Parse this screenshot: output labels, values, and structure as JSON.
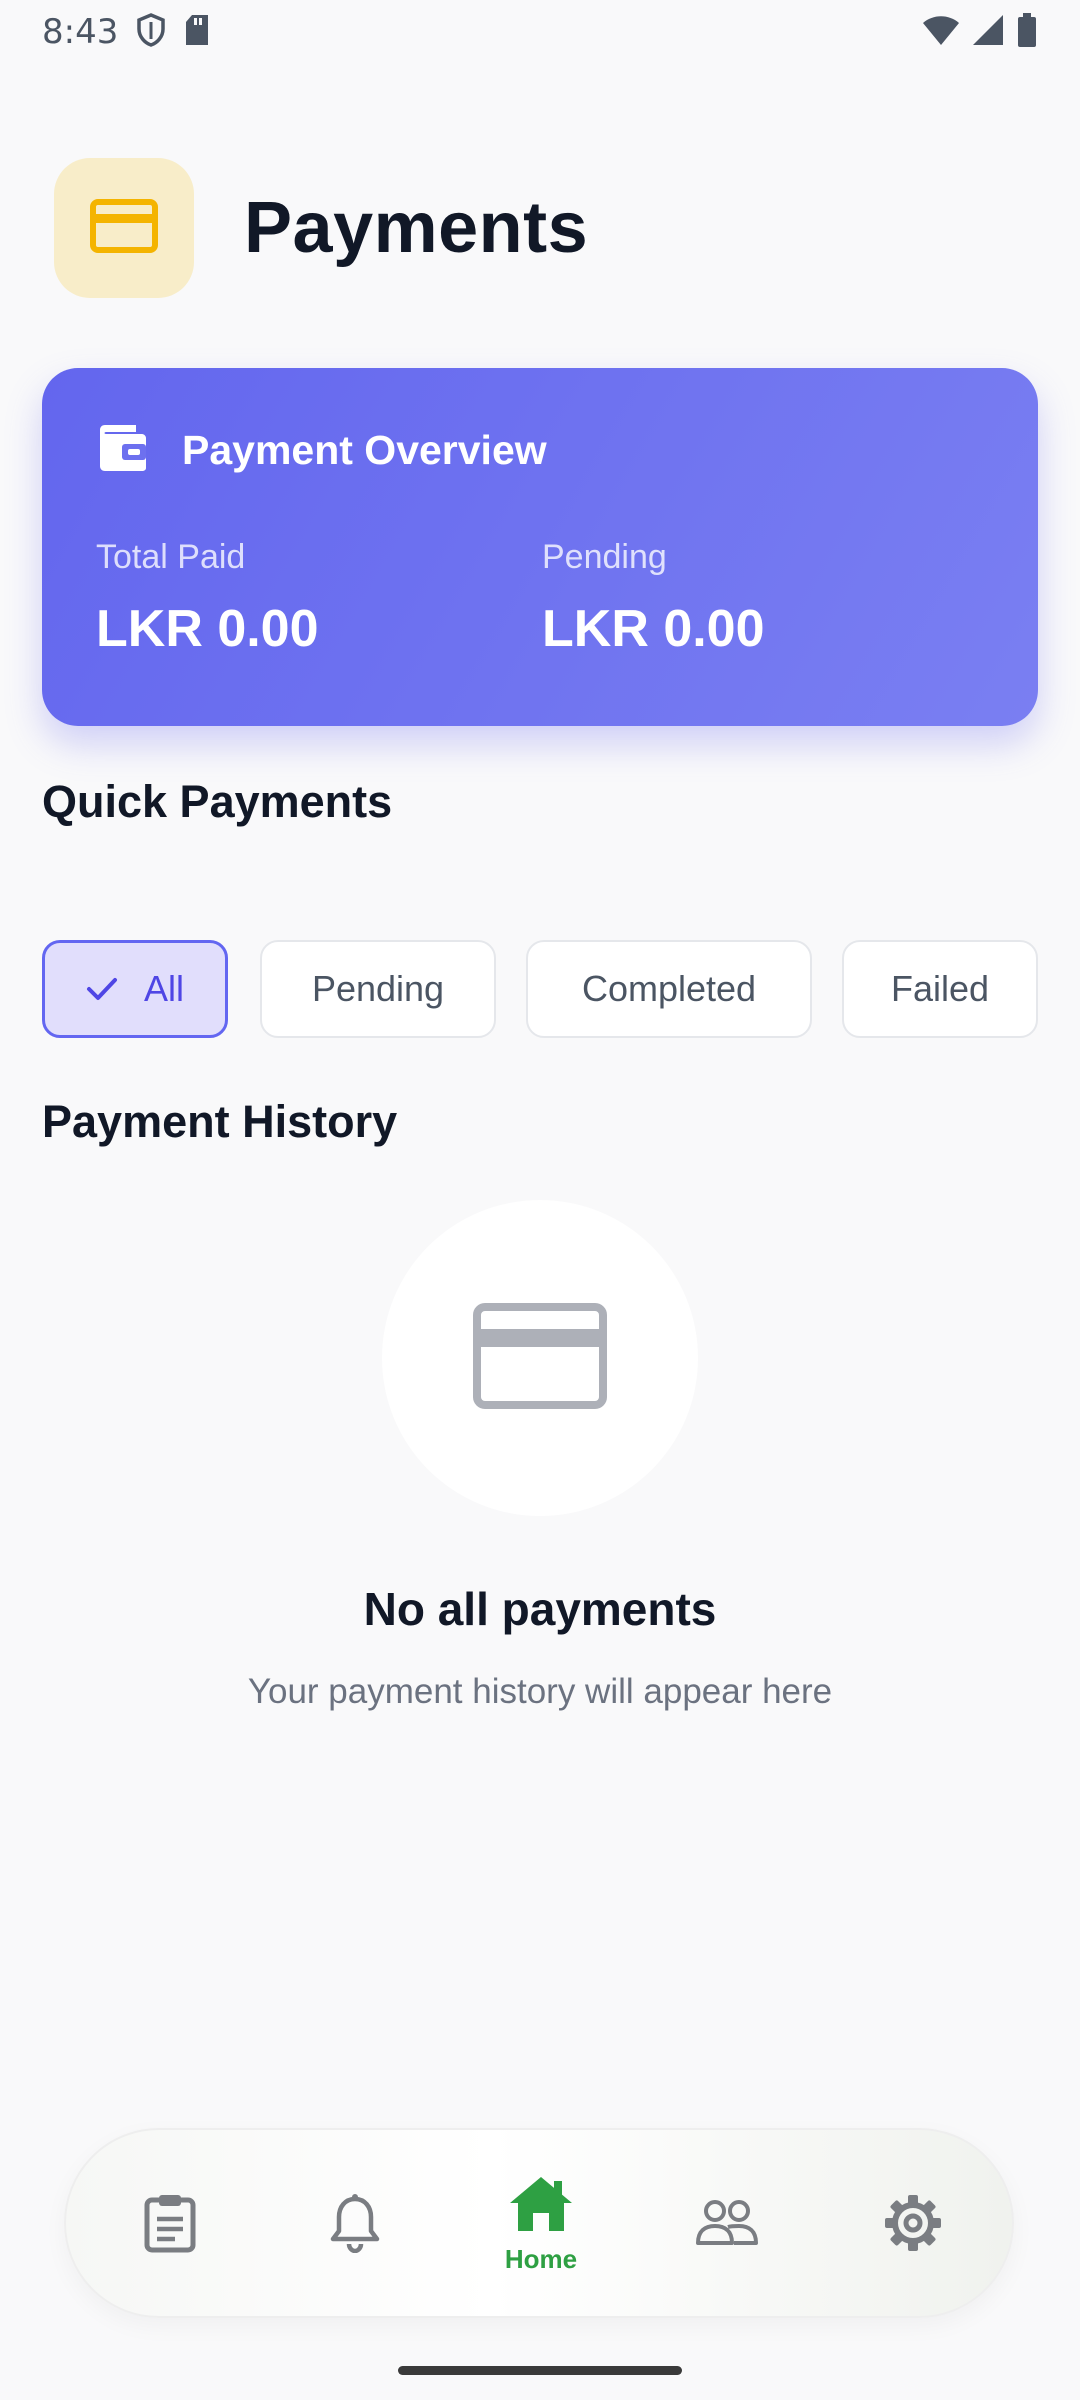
{
  "status_bar": {
    "time": "8:43",
    "icons": [
      "shield-icon",
      "sd-card-icon",
      "wifi-icon",
      "signal-icon",
      "battery-icon"
    ]
  },
  "header": {
    "title": "Payments",
    "icon": "credit-card-icon",
    "icon_color": "#f4b400",
    "icon_bg": "#f8edc9"
  },
  "overview": {
    "title": "Payment Overview",
    "icon": "wallet-icon",
    "total_paid_label": "Total Paid",
    "total_paid_value": "LKR 0.00",
    "pending_label": "Pending",
    "pending_value": "LKR 0.00",
    "gradient": [
      "#6366ee",
      "#7a7ff2"
    ]
  },
  "quick_payments": {
    "title": "Quick Payments"
  },
  "filters": {
    "items": [
      {
        "label": "All",
        "active": true
      },
      {
        "label": "Pending",
        "active": false
      },
      {
        "label": "Completed",
        "active": false
      },
      {
        "label": "Failed",
        "active": false
      }
    ],
    "accent": "#6366f1"
  },
  "history": {
    "title": "Payment History",
    "empty_icon": "credit-card-icon",
    "empty_title": "No all payments",
    "empty_subtitle": "Your payment history will appear here"
  },
  "bottom_nav": {
    "items": [
      {
        "icon": "clipboard-icon",
        "label": ""
      },
      {
        "icon": "bell-icon",
        "label": ""
      },
      {
        "icon": "home-icon",
        "label": "Home",
        "active": true
      },
      {
        "icon": "people-icon",
        "label": ""
      },
      {
        "icon": "gear-icon",
        "label": ""
      }
    ],
    "active_color": "#2ea043"
  }
}
